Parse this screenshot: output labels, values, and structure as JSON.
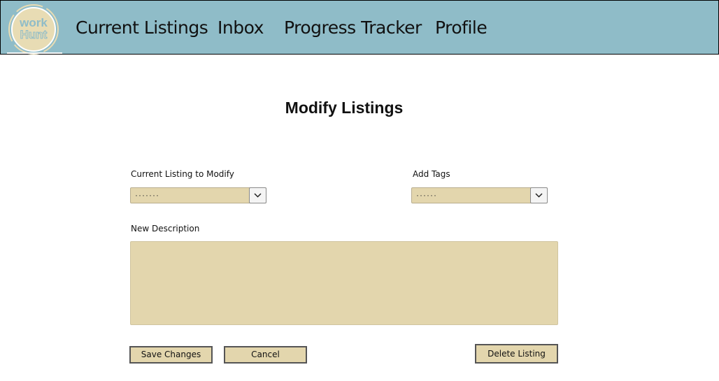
{
  "logo": {
    "line1": "work",
    "line2": "Hunt"
  },
  "nav": {
    "items": [
      {
        "label": "Current Listings"
      },
      {
        "label": "Inbox"
      },
      {
        "label": "Progress Tracker"
      },
      {
        "label": "Profile"
      }
    ]
  },
  "page": {
    "title": "Modify Listings"
  },
  "form": {
    "listing_label": "Current Listing to Modify",
    "listing_value": "·······",
    "tags_label": "Add Tags",
    "tags_value": "······",
    "description_label": "New Description",
    "description_value": ""
  },
  "buttons": {
    "save": "Save Changes",
    "cancel": "Cancel",
    "delete": "Delete Listing"
  },
  "colors": {
    "navbar": "#8fbcc8",
    "field_fill": "#e3d6ad"
  }
}
